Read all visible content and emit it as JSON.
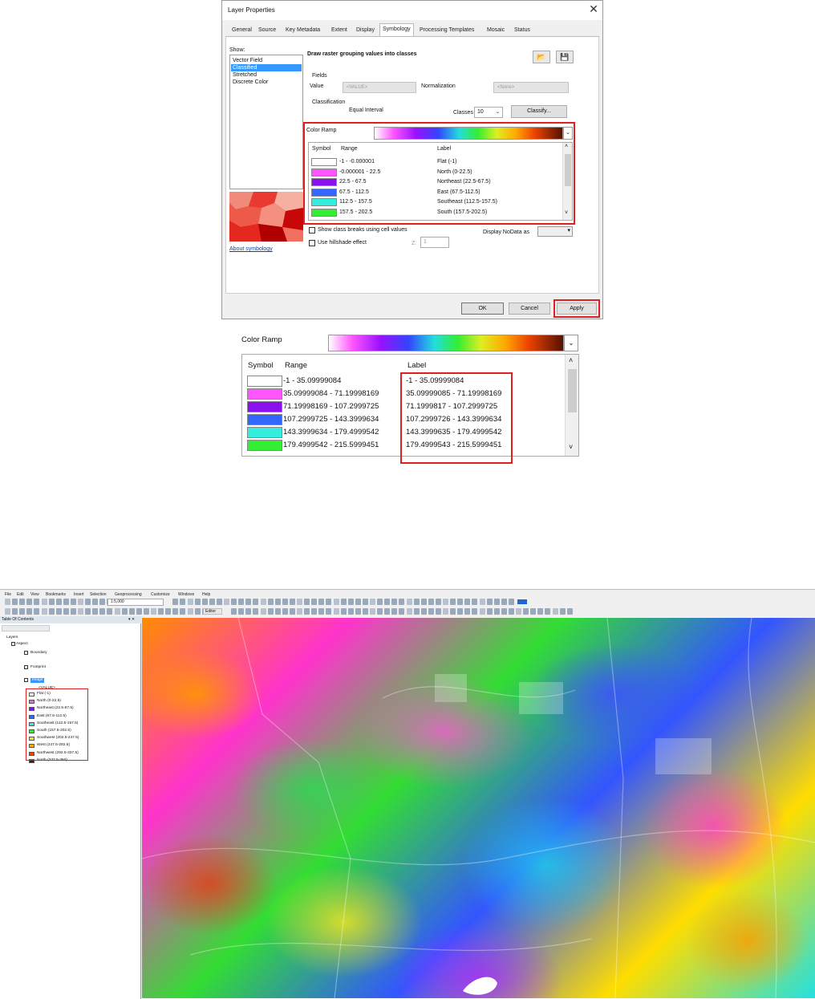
{
  "dialog": {
    "title": "Layer Properties",
    "close": "✕",
    "tabs": [
      "General",
      "Source",
      "Key Metadata",
      "Extent",
      "Display",
      "Symbology",
      "Processing Templates",
      "Mosaic",
      "Status"
    ],
    "active_tab": "Symbology",
    "show": {
      "label": "Show:",
      "items": [
        "Vector Field",
        "Classified",
        "Stretched",
        "Discrete Color"
      ],
      "selected": "Classified"
    },
    "about_link": "About symbology",
    "heading": "Draw raster grouping values into classes",
    "fields": {
      "group_label": "Fields",
      "value_label": "Value",
      "value_field": "<VALUE>",
      "normalization_label": "Normalization",
      "normalization_field": "<None>"
    },
    "classification": {
      "group_label": "Classification",
      "method": "Equal Interval",
      "classes_label": "Classes",
      "classes_value": "10",
      "classify_button": "Classify..."
    },
    "color_ramp_label": "Color Ramp",
    "table": {
      "headers": {
        "symbol": "Symbol",
        "range": "Range",
        "label": "Label"
      },
      "rows": [
        {
          "color": "#ffffff",
          "range": "-1 - -0.000001",
          "label": "Flat (-1)"
        },
        {
          "color": "#ff55ff",
          "range": "-0.000001 - 22.5",
          "label": "North (0-22.5)"
        },
        {
          "color": "#8a10ee",
          "range": "22.5 - 67.5",
          "label": "Northeast (22.5-67.5)"
        },
        {
          "color": "#3366ff",
          "range": "67.5 - 112.5",
          "label": "East (67.5-112.5)"
        },
        {
          "color": "#33eedd",
          "range": "112.5 - 157.5",
          "label": "Southeast (112.5-157.5)"
        },
        {
          "color": "#33ee33",
          "range": "157.5 - 202.5",
          "label": "South (157.5-202.5)"
        }
      ]
    },
    "show_breaks_label": "Show class breaks using cell values",
    "hillshade_label": "Use hillshade effect",
    "z_label": "Z:",
    "z_value": "1",
    "nodata_label": "Display NoData as",
    "ok_button": "OK",
    "cancel_button": "Cancel",
    "apply_button": "Apply"
  },
  "zoom": {
    "color_ramp_label": "Color Ramp",
    "headers": {
      "symbol": "Symbol",
      "range": "Range",
      "label": "Label"
    },
    "rows": [
      {
        "color": "#ffffff",
        "range": "-1 - 35.09999084",
        "label": "-1 - 35.09999084"
      },
      {
        "color": "#ff55ff",
        "range": "35.09999084 - 71.19998169",
        "label": "35.09999085 - 71.19998169"
      },
      {
        "color": "#8a10ee",
        "range": "71.19998169 - 107.2999725",
        "label": "71.1999817 - 107.2999725"
      },
      {
        "color": "#3366ff",
        "range": "107.2999725 - 143.3999634",
        "label": "107.2999726 - 143.3999634"
      },
      {
        "color": "#33eedd",
        "range": "143.3999634 - 179.4999542",
        "label": "143.3999635 - 179.4999542"
      },
      {
        "color": "#33ee33",
        "range": "179.4999542 - 215.5999451",
        "label": "179.4999543 - 215.5999451"
      }
    ]
  },
  "arcmap": {
    "menu": [
      "File",
      "Edit",
      "View",
      "Bookmarks",
      "Insert",
      "Selection",
      "Geoprocessing",
      "Customize",
      "Windows",
      "Help"
    ],
    "scale": "1:5,000",
    "editor_label": "Editor",
    "toc": {
      "title": "Table Of Contents",
      "layers_root": "Layers",
      "layers": [
        "Aspect",
        "Boundary",
        "Footprint",
        "Image"
      ],
      "value_field": "<VALUE>",
      "legend": [
        {
          "color": "#ffffff",
          "label": "Flat (-1)"
        },
        {
          "color": "#ff55ff",
          "label": "North (0-22.5)"
        },
        {
          "color": "#8a10ee",
          "label": "Northeast (22.5-67.5)"
        },
        {
          "color": "#3366ff",
          "label": "East (67.5-112.5)"
        },
        {
          "color": "#33eedd",
          "label": "Southeast (112.5-157.5)"
        },
        {
          "color": "#33ee33",
          "label": "South (157.5-202.5)"
        },
        {
          "color": "#ddee22",
          "label": "Southwest (202.5-247.5)"
        },
        {
          "color": "#ffaa00",
          "label": "West (247.5-292.5)"
        },
        {
          "color": "#ee4400",
          "label": "Northwest (292.5-337.5)"
        },
        {
          "color": "#551100",
          "label": "North (337.5-360)"
        }
      ]
    }
  },
  "colors": {
    "highlight": "#e02020",
    "selection": "#3399ff"
  }
}
